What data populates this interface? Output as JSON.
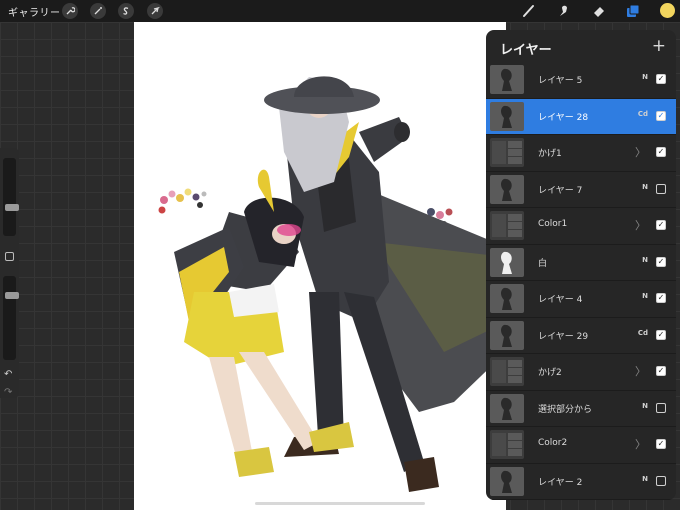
{
  "toolbar": {
    "gallery_label": "ギャラリー",
    "left_tools": [
      "wrench-icon",
      "magic-wand-icon",
      "selection-s-icon",
      "arrow-transform-icon"
    ],
    "right_tools": [
      "brush-icon",
      "smudge-icon",
      "eraser-icon",
      "layers-icon"
    ],
    "current_color": "#f2d55e"
  },
  "layers_panel": {
    "title": "レイヤー",
    "add_label": "+",
    "selected_color": "#2f7de1",
    "layers": [
      {
        "name": "レイヤー 5",
        "mode": "N",
        "group": false,
        "visible": true
      },
      {
        "name": "レイヤー 28",
        "mode": "Cd",
        "group": false,
        "visible": true
      },
      {
        "name": "かげ1",
        "mode": "",
        "group": true,
        "visible": true
      },
      {
        "name": "レイヤー 7",
        "mode": "N",
        "group": false,
        "visible": false
      },
      {
        "name": "Color1",
        "mode": "",
        "group": true,
        "visible": true
      },
      {
        "name": "白",
        "mode": "N",
        "group": false,
        "visible": true
      },
      {
        "name": "レイヤー 4",
        "mode": "N",
        "group": false,
        "visible": true
      },
      {
        "name": "レイヤー 29",
        "mode": "Cd",
        "group": false,
        "visible": true
      },
      {
        "name": "かげ2",
        "mode": "",
        "group": true,
        "visible": true
      },
      {
        "name": "選択部分から",
        "mode": "N",
        "group": false,
        "visible": false
      },
      {
        "name": "Color2",
        "mode": "",
        "group": true,
        "visible": true
      },
      {
        "name": "レイヤー 2",
        "mode": "N",
        "group": false,
        "visible": false
      }
    ]
  },
  "checkmark": "✓",
  "chevron": "〉",
  "sidebar": {
    "undo": "↶",
    "redo": "↷"
  }
}
